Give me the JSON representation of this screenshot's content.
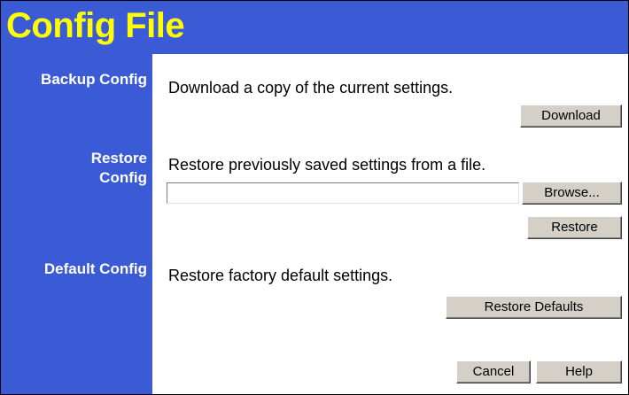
{
  "header": {
    "title": "Config File"
  },
  "sections": {
    "backup": {
      "label": "Backup Config",
      "description": "Download a copy of the current settings.",
      "button": "Download"
    },
    "restore": {
      "label_line1": "Restore",
      "label_line2": "Config",
      "description": "Restore previously saved settings from a file.",
      "file_value": "",
      "browse_button": "Browse...",
      "restore_button": "Restore"
    },
    "default": {
      "label": "Default Config",
      "description": "Restore factory default settings.",
      "button": "Restore Defaults"
    }
  },
  "footer": {
    "cancel": "Cancel",
    "help": "Help"
  },
  "colors": {
    "header_bg": "#3b5bd6",
    "title": "#ffff00",
    "sidebar_text": "#ffffff",
    "button_bg": "#d4d0c8"
  }
}
